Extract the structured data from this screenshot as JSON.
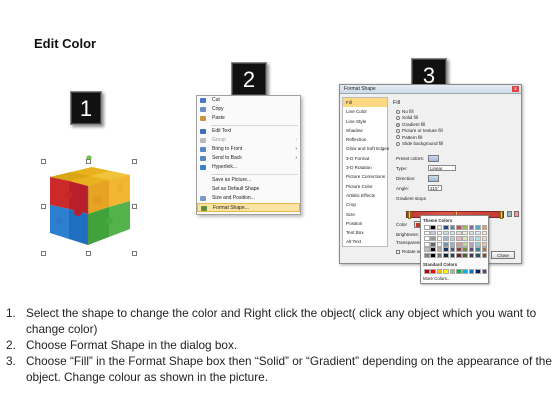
{
  "title": "Edit Color",
  "badges": [
    "1",
    "2",
    "3"
  ],
  "context_menu": {
    "items": [
      {
        "label": "Cut",
        "icon": "scissors-icon",
        "color": "#4a78c2",
        "disabled": false
      },
      {
        "label": "Copy",
        "icon": "copy-icon",
        "color": "#6a8fc8",
        "disabled": false
      },
      {
        "label": "Paste",
        "icon": "paste-icon",
        "color": "#c8963e",
        "disabled": false
      },
      {
        "sep": true
      },
      {
        "label": "Edit Text",
        "icon": "edit-text-icon",
        "color": "#3f6fb0",
        "disabled": false
      },
      {
        "label": "Group",
        "icon": "group-icon",
        "color": "#bbbbbb",
        "disabled": true,
        "arrow": "›"
      },
      {
        "label": "Bring to Front",
        "icon": "bring-front-icon",
        "color": "#5a86c5",
        "disabled": false,
        "arrow": "›"
      },
      {
        "label": "Send to Back",
        "icon": "send-back-icon",
        "color": "#5a86c5",
        "disabled": false,
        "arrow": "›"
      },
      {
        "label": "Hyperlink...",
        "icon": "hyperlink-icon",
        "color": "#3f7fc4",
        "disabled": false
      },
      {
        "sep": true
      },
      {
        "label": "Save as Picture...",
        "icon": "",
        "color": "",
        "disabled": false
      },
      {
        "label": "Set as Default Shape",
        "icon": "",
        "color": "",
        "disabled": false
      },
      {
        "label": "Size and Position...",
        "icon": "size-position-icon",
        "color": "#7c9ac0",
        "disabled": false
      },
      {
        "label": "Format Shape...",
        "icon": "format-shape-icon",
        "color": "#5f8f3e",
        "disabled": false,
        "highlight": true
      }
    ]
  },
  "dialog": {
    "title": "Format Shape",
    "close_glyph": "x",
    "categories": [
      "Fill",
      "Line Color",
      "Line Style",
      "Shadow",
      "Reflection",
      "Glow and Soft Edges",
      "3-D Format",
      "3-D Rotation",
      "Picture Corrections",
      "Picture Color",
      "Artistic Effects",
      "Crop",
      "Size",
      "Position",
      "Text Box",
      "Alt Text"
    ],
    "active_category": "Fill",
    "fill_heading": "Fill",
    "fill_options": [
      "No fill",
      "Solid fill",
      "Gradient fill",
      "Picture or texture fill",
      "Pattern fill",
      "Slide background fill"
    ],
    "selected_fill": "Gradient fill",
    "fields": {
      "preset_label": "Preset colors:",
      "type_label": "Type:",
      "type_value": "Linear",
      "direction_label": "Direction:",
      "angle_label": "Angle:",
      "angle_value": "315°",
      "gradient_label": "Gradient stops",
      "color_label": "Color",
      "position_label": "Position:",
      "position_value": "52%",
      "brightness_label": "Brightness:",
      "transparency_label": "Transparency:",
      "rotate_label": "Rotate with shape"
    },
    "close_button": "Close"
  },
  "color_popup": {
    "theme_label": "Theme Colors",
    "standard_label": "Standard Colors",
    "more_label": "More Colors...",
    "theme_top": [
      "#ffffff",
      "#000000",
      "#eeece1",
      "#1f497d",
      "#4f81bd",
      "#c0504d",
      "#9bbb59",
      "#8064a2",
      "#4bacc6",
      "#f79646"
    ],
    "standard": [
      "#c00000",
      "#ff0000",
      "#ffc000",
      "#ffff00",
      "#92d050",
      "#00b050",
      "#00b0f0",
      "#0070c0",
      "#002060",
      "#7030a0"
    ]
  },
  "instructions": [
    {
      "num": "1.",
      "text": "Select the shape to change the color and Right click the object( click any object which you want to change color)"
    },
    {
      "num": "2.",
      "text": "Choose Format Shape in the dialog box."
    },
    {
      "num": "3.",
      "text": "Choose “Fill” in the Format Shape box then “Solid” or “Gradient” depending on the appearance of the object. Change colour as shown in the picture."
    }
  ]
}
